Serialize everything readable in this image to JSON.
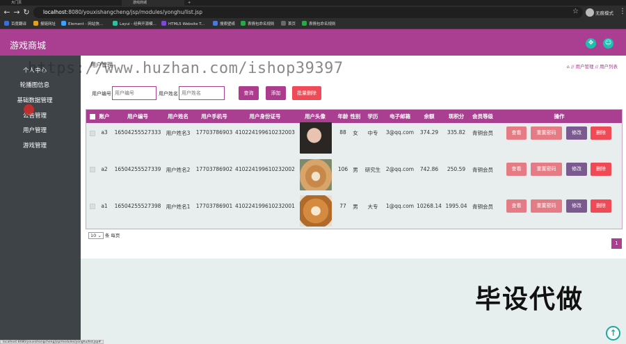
{
  "browser": {
    "tabs": [
      {
        "label": "大门页"
      },
      {
        "label": "游戏商城"
      }
    ],
    "url_host": "localhost",
    "url_path": ":8080/youxishangcheng/jsp/modules/yonghu/list.jsp",
    "profile_name": "无痕模式",
    "bookmarks": [
      {
        "label": "百度翻译",
        "color": "#3a6fd8"
      },
      {
        "label": "报链网址",
        "color": "#e0a020"
      },
      {
        "label": "Element - 网站快...",
        "color": "#409eff"
      },
      {
        "label": "Layui - 经典开源模...",
        "color": "#2fc0a0"
      },
      {
        "label": "HTML5 Website T...",
        "color": "#7b4bd6"
      },
      {
        "label": "搜索壁纸",
        "color": "#4a7ad8"
      },
      {
        "label": "表情包命名规则",
        "color": "#2aa84a"
      },
      {
        "label": "首页",
        "color": "#6a6a6a"
      },
      {
        "label": "表情包命名规则",
        "color": "#2aa84a"
      }
    ]
  },
  "app": {
    "title": "游戏商城",
    "header_icons": [
      "expand-icon",
      "user-icon"
    ]
  },
  "sidebar": {
    "items": [
      {
        "label": "个人中心"
      },
      {
        "label": "轮播图信息"
      },
      {
        "label": "基础数据管理"
      },
      {
        "label": "公告管理"
      },
      {
        "label": "用户管理"
      },
      {
        "label": "游戏管理"
      }
    ]
  },
  "page": {
    "title": "用户管理",
    "breadcrumb": [
      "用户管理",
      "用户列表"
    ]
  },
  "search": {
    "label_number": "用户编号",
    "placeholder_number": "用户编号",
    "label_name": "用户姓名",
    "placeholder_name": "用户姓名",
    "btn_search": "查询",
    "btn_add": "添加",
    "btn_batch_delete": "批量删除"
  },
  "table": {
    "headers": [
      "账户",
      "用户编号",
      "用户姓名",
      "用户手机号",
      "用户身份证号",
      "用户头像",
      "年龄",
      "性别",
      "学历",
      "电子邮箱",
      "余额",
      "现积分",
      "会员等级",
      "操作"
    ],
    "rows": [
      {
        "account": "a3",
        "number": "16504255527333",
        "name": "用户姓名3",
        "phone": "17703786903",
        "id_card": "410224199610232003",
        "avatar": "woman-avatar",
        "age": "88",
        "gender": "女",
        "education": "中专",
        "email": "3@qq.com",
        "balance": "374.29",
        "points": "335.82",
        "level": "青铜会员"
      },
      {
        "account": "a2",
        "number": "16504255527339",
        "name": "用户姓名2",
        "phone": "17703786902",
        "id_card": "410224199610232002",
        "avatar": "dog-avatar",
        "age": "106",
        "gender": "男",
        "education": "研究生",
        "email": "2@qq.com",
        "balance": "742.86",
        "points": "250.59",
        "level": "青铜会员"
      },
      {
        "account": "a1",
        "number": "16504255527398",
        "name": "用户姓名1",
        "phone": "17703786901",
        "id_card": "410224199610232001",
        "avatar": "dog-avatar",
        "age": "77",
        "gender": "男",
        "education": "大专",
        "email": "1@qq.com",
        "balance": "10268.14",
        "points": "1995.04",
        "level": "青铜会员"
      }
    ],
    "row_actions": {
      "view": "查看",
      "reset_password": "重置密码",
      "edit": "修改",
      "delete": "删除"
    }
  },
  "pagination": {
    "page_size": "10",
    "page_size_suffix": "条 每页",
    "current_page": "1"
  },
  "overlay": {
    "watermark": "https://www.huzhan.com/ishop39397",
    "promo_text": "毕设代做"
  },
  "statusbar": {
    "text": "localhost:8080/youxishangcheng/jsp/modules/yonghu/list.jsp#"
  },
  "colors": {
    "primary": "#aa3f92",
    "danger": "#f04a56",
    "soft_red": "#e57b84",
    "edit_purple": "#7b5a8f",
    "teal": "#1dbfb1",
    "sidebar_bg": "#3d4347"
  }
}
